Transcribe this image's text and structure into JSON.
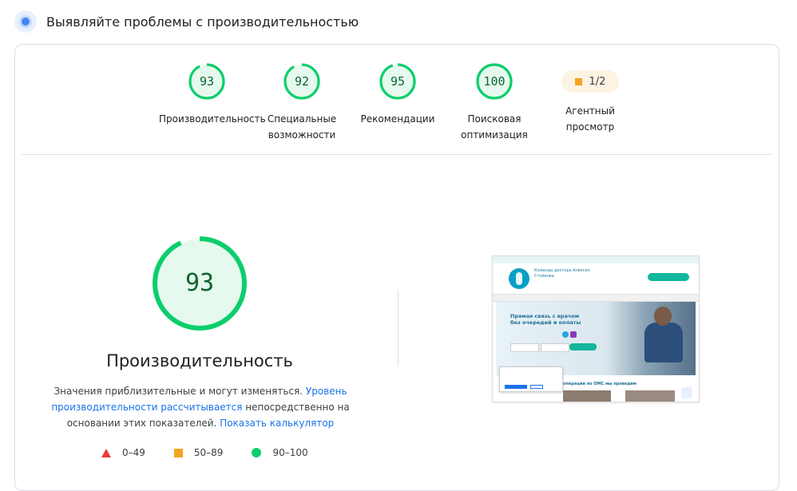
{
  "header": {
    "title": "Выявляйте проблемы с производительностью"
  },
  "categories": [
    {
      "score": "93",
      "value": 93,
      "label_line1": "Производительность",
      "label_line2": ""
    },
    {
      "score": "92",
      "value": 92,
      "label_line1": "Специальные",
      "label_line2": "возможности"
    },
    {
      "score": "95",
      "value": 95,
      "label_line1": "Рекомендации",
      "label_line2": ""
    },
    {
      "score": "100",
      "value": 100,
      "label_line1": "Поисковая",
      "label_line2": "оптимизация"
    },
    {
      "score": "1/2",
      "label_line1": "Агентный",
      "label_line2": "просмотр"
    }
  ],
  "main": {
    "score": "93",
    "value": 93,
    "title": "Производительность",
    "desc_text1": "Значения приблизительные и могут изменяться. ",
    "desc_link1": "Уровень производительности рассчитывается",
    "desc_text2": " непосредственно на основании этих показателей. ",
    "desc_link2": "Показать калькулятор"
  },
  "legend": {
    "red": "0–49",
    "orange": "50–89",
    "green": "90–100"
  },
  "screenshot": {
    "site_name": "Команда доктора Алексея Стойкова",
    "hero_title": "Прямая связь с врачом без очередей и оплаты",
    "bottom_text": "операции по ОМС мы проводим"
  },
  "colors": {
    "pass": "#0cce6b",
    "pass_text": "#0d652d",
    "pass_bg": "#e6f9ee",
    "average": "#f4a522",
    "fail": "#eb3b3b",
    "link": "#1a73e8"
  }
}
